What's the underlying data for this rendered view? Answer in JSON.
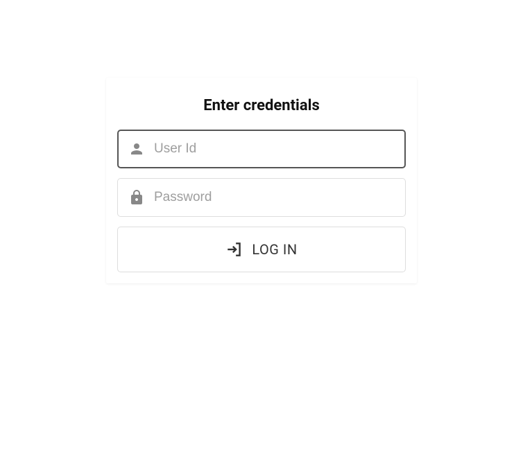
{
  "title": "Enter credentials",
  "fields": {
    "userId": {
      "placeholder": "User Id",
      "value": ""
    },
    "password": {
      "placeholder": "Password",
      "value": ""
    }
  },
  "button": {
    "label": "LOG IN"
  }
}
